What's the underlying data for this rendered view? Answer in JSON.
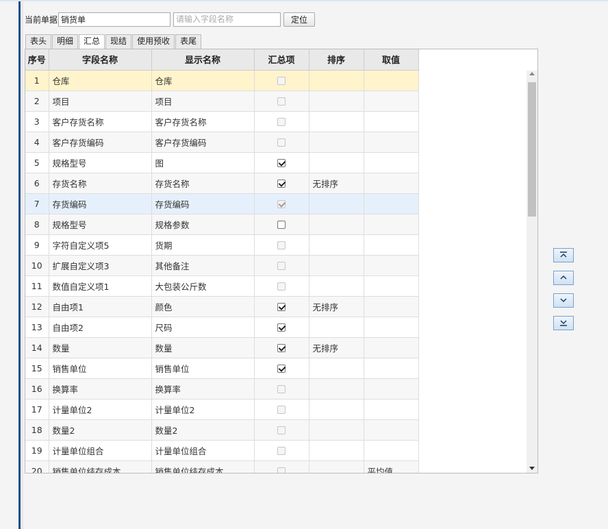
{
  "toolbar": {
    "doc_label": "当前单据",
    "doc_value": "销货单",
    "search_placeholder": "请输入字段名称",
    "locate_label": "定位"
  },
  "tabs": [
    {
      "label": "表头"
    },
    {
      "label": "明细"
    },
    {
      "label": "汇总"
    },
    {
      "label": "现结"
    },
    {
      "label": "使用预收"
    },
    {
      "label": "表尾"
    }
  ],
  "active_tab": "汇总",
  "table": {
    "headers": [
      "序号",
      "字段名称",
      "显示名称",
      "汇总项",
      "排序",
      "取值"
    ],
    "rows": [
      {
        "idx": "1",
        "field": "仓库",
        "display": "仓库",
        "checked": false,
        "enabled": false,
        "sort": "",
        "value": ""
      },
      {
        "idx": "2",
        "field": "项目",
        "display": "项目",
        "checked": false,
        "enabled": false,
        "sort": "",
        "value": ""
      },
      {
        "idx": "3",
        "field": "客户存货名称",
        "display": "客户存货名称",
        "checked": false,
        "enabled": false,
        "sort": "",
        "value": ""
      },
      {
        "idx": "4",
        "field": "客户存货编码",
        "display": "客户存货编码",
        "checked": false,
        "enabled": false,
        "sort": "",
        "value": ""
      },
      {
        "idx": "5",
        "field": "规格型号",
        "display": "图",
        "checked": true,
        "enabled": true,
        "sort": "",
        "value": ""
      },
      {
        "idx": "6",
        "field": "存货名称",
        "display": "存货名称",
        "checked": true,
        "enabled": true,
        "sort": "无排序",
        "value": ""
      },
      {
        "idx": "7",
        "field": "存货编码",
        "display": "存货编码",
        "checked": true,
        "enabled": false,
        "sort": "",
        "value": ""
      },
      {
        "idx": "8",
        "field": "规格型号",
        "display": "规格参数",
        "checked": false,
        "enabled": true,
        "sort": "",
        "value": ""
      },
      {
        "idx": "9",
        "field": "字符自定义项5",
        "display": "货期",
        "checked": false,
        "enabled": false,
        "sort": "",
        "value": ""
      },
      {
        "idx": "10",
        "field": "扩展自定义项3",
        "display": "其他备注",
        "checked": false,
        "enabled": false,
        "sort": "",
        "value": ""
      },
      {
        "idx": "11",
        "field": "数值自定义项1",
        "display": "大包装公斤数",
        "checked": false,
        "enabled": false,
        "sort": "",
        "value": ""
      },
      {
        "idx": "12",
        "field": "自由项1",
        "display": "颜色",
        "checked": true,
        "enabled": true,
        "sort": "无排序",
        "value": ""
      },
      {
        "idx": "13",
        "field": "自由项2",
        "display": "尺码",
        "checked": true,
        "enabled": true,
        "sort": "",
        "value": ""
      },
      {
        "idx": "14",
        "field": "数量",
        "display": "数量",
        "checked": true,
        "enabled": true,
        "sort": "无排序",
        "value": ""
      },
      {
        "idx": "15",
        "field": "销售单位",
        "display": "销售单位",
        "checked": true,
        "enabled": true,
        "sort": "",
        "value": ""
      },
      {
        "idx": "16",
        "field": "换算率",
        "display": "换算率",
        "checked": false,
        "enabled": false,
        "sort": "",
        "value": ""
      },
      {
        "idx": "17",
        "field": "计量单位2",
        "display": "计量单位2",
        "checked": false,
        "enabled": false,
        "sort": "",
        "value": ""
      },
      {
        "idx": "18",
        "field": "数量2",
        "display": "数量2",
        "checked": false,
        "enabled": false,
        "sort": "",
        "value": ""
      },
      {
        "idx": "19",
        "field": "计量单位组合",
        "display": "计量单位组合",
        "checked": false,
        "enabled": false,
        "sort": "",
        "value": ""
      },
      {
        "idx": "20",
        "field": "销售单位结存成本",
        "display": "销售单位结存成本",
        "checked": false,
        "enabled": false,
        "sort": "",
        "value": "平均值"
      }
    ]
  },
  "selected_row": "1",
  "highlighted_row": "7",
  "move_buttons": [
    {
      "icon": "move-top-icon"
    },
    {
      "icon": "move-up-icon"
    },
    {
      "icon": "move-down-icon"
    },
    {
      "icon": "move-bottom-icon"
    }
  ]
}
